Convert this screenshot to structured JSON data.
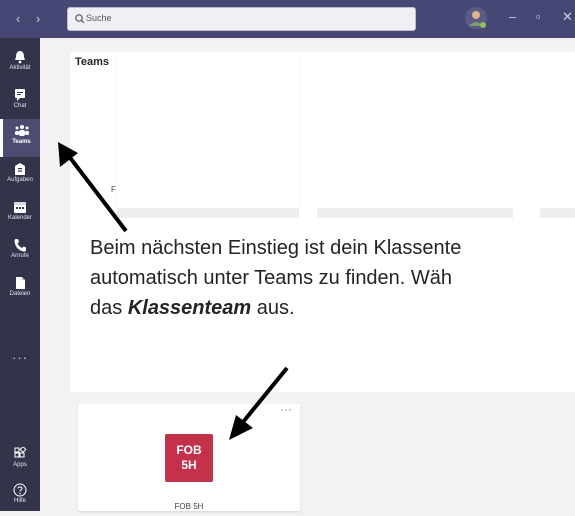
{
  "titlebar": {
    "back": "‹",
    "forward": "›",
    "search_placeholder": "Suche",
    "minimize": "–",
    "maximize": "▫",
    "close": "✕"
  },
  "rail": {
    "items": [
      {
        "label": "Aktivität",
        "icon": "bell-icon"
      },
      {
        "label": "Chat",
        "icon": "chat-icon"
      },
      {
        "label": "Teams",
        "icon": "teams-icon"
      },
      {
        "label": "Aufgaben",
        "icon": "assignments-icon"
      },
      {
        "label": "Kalender",
        "icon": "calendar-icon"
      },
      {
        "label": "Anrufe",
        "icon": "phone-icon"
      },
      {
        "label": "Dateien",
        "icon": "file-icon"
      }
    ],
    "more": "···",
    "bottom": [
      {
        "label": "Apps",
        "icon": "apps-icon"
      },
      {
        "label": "Hilfe",
        "icon": "help-icon"
      }
    ]
  },
  "main": {
    "title": "Teams",
    "tiny_label": "F",
    "instruction": {
      "line1": "Beim nächsten Einstieg ist dein Klassente",
      "line2": "automatisch unter Teams zu finden. Wäh",
      "line3_prefix": "das ",
      "line3_bold": "Klassenteam",
      "line3_suffix": " aus."
    }
  },
  "team_card": {
    "logo_line1": "FOB",
    "logo_line2": "5H",
    "name": "FOB 5H",
    "more": "···",
    "logo_color": "#c4314b"
  },
  "colors": {
    "titlebar": "#464775",
    "rail": "#33344a",
    "accent": "#c4314b"
  }
}
